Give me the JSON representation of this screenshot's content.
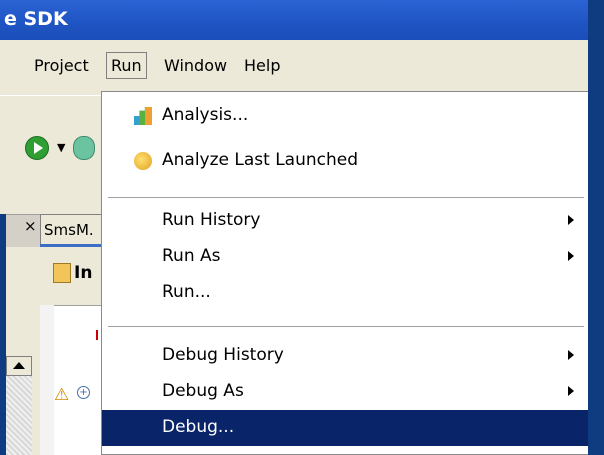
{
  "window": {
    "title": "e SDK"
  },
  "menubar": {
    "items": [
      {
        "label": "Project"
      },
      {
        "label": "Run"
      },
      {
        "label": "Window"
      },
      {
        "label": "Help"
      }
    ]
  },
  "editor": {
    "tab_label": "SmsM.",
    "header_label": "In"
  },
  "run_menu": {
    "analysis": "Analysis...",
    "analyze_last_launched": "Analyze Last Launched",
    "run_history": "Run History",
    "run_as": "Run As",
    "run": "Run...",
    "debug_history": "Debug History",
    "debug_as": "Debug As",
    "debug": "Debug..."
  },
  "colors": {
    "selection": "#0a246a",
    "titlebar": "#1f55c4",
    "menu_background": "#ffffff"
  },
  "icons": {
    "analysis": "analysis-icon",
    "analyze_last": "analyze-last-icon",
    "run": "run-icon",
    "debug": "debug-icon",
    "warning": "warning-icon"
  }
}
